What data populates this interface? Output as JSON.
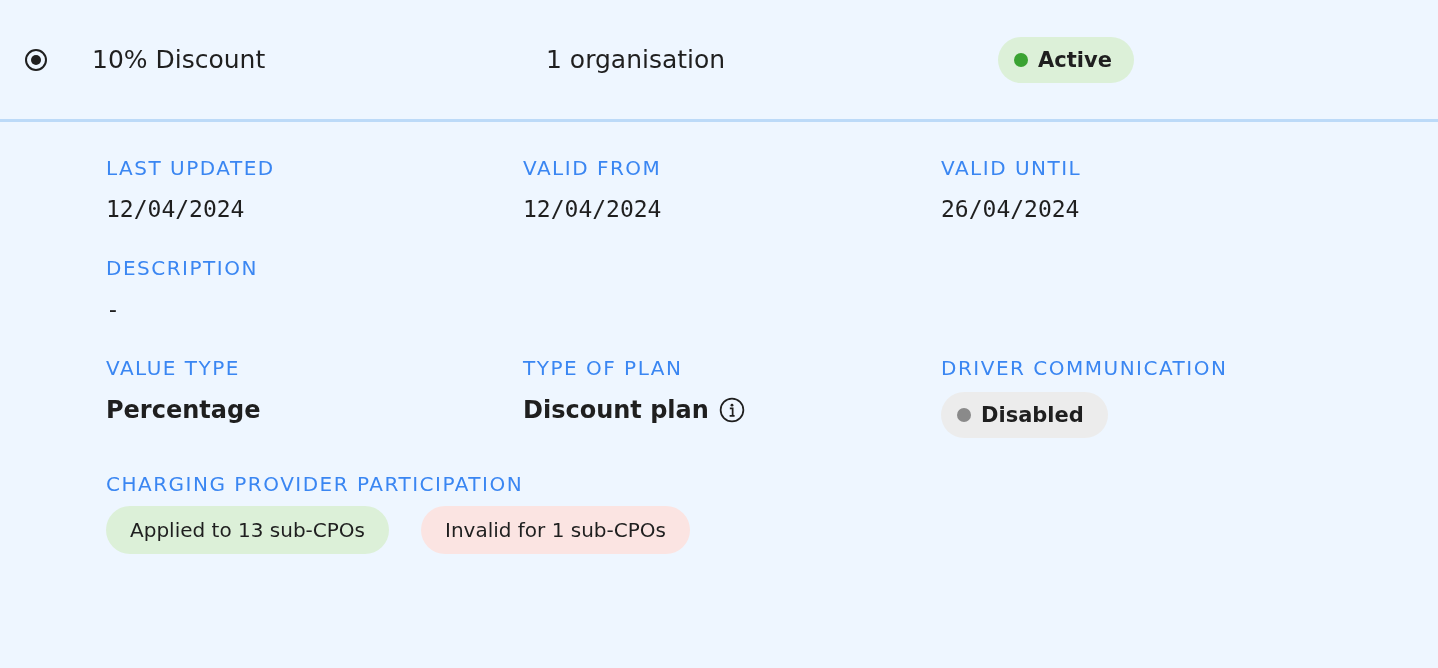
{
  "row": {
    "selected": true,
    "name": "10% Discount",
    "organisations": "1 organisation",
    "status": {
      "label": "Active",
      "kind": "active"
    }
  },
  "details": [
    [
      {
        "label": "LAST UPDATED",
        "value": "12/04/2024",
        "kind": "date"
      },
      {
        "label": "VALID FROM",
        "value": "12/04/2024",
        "kind": "date"
      },
      {
        "label": "VALID UNTIL",
        "value": "26/04/2024",
        "kind": "date"
      }
    ],
    [
      {
        "label": "DESCRIPTION",
        "value": "-",
        "kind": "date"
      }
    ],
    [
      {
        "label": "VALUE TYPE",
        "value": "Percentage",
        "kind": "text"
      },
      {
        "label": "TYPE OF PLAN",
        "value": "Discount plan",
        "kind": "info"
      },
      {
        "label": "DRIVER COMMUNICATION",
        "value": "Disabled",
        "kind": "status",
        "enabled": false
      }
    ]
  ],
  "participation": {
    "label": "CHARGING PROVIDER PARTICIPATION",
    "tags": [
      {
        "label": "Applied to 13 sub-CPOs",
        "kind": "success"
      },
      {
        "label": "Invalid for 1 sub-CPOs",
        "kind": "error"
      }
    ]
  }
}
